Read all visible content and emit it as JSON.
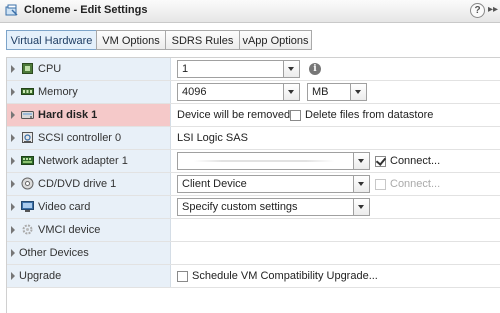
{
  "window": {
    "title": "Cloneme - Edit Settings",
    "help_symbol": "?",
    "more_symbol": "▸▸"
  },
  "tabs": [
    {
      "label": "Virtual Hardware",
      "active": true
    },
    {
      "label": "VM Options",
      "active": false
    },
    {
      "label": "SDRS Rules",
      "active": false
    },
    {
      "label": "vApp Options",
      "active": false
    }
  ],
  "hardware": {
    "cpu": {
      "label": "CPU",
      "value": "1"
    },
    "memory": {
      "label": "Memory",
      "value": "4096",
      "unit": "MB"
    },
    "hard_disk": {
      "label": "Hard disk 1",
      "status": "Device will be removed",
      "delete_files_label": "Delete files from datastore",
      "delete_files_checked": false
    },
    "scsi": {
      "label": "SCSI controller 0",
      "value": "LSI Logic SAS"
    },
    "network": {
      "label": "Network adapter 1",
      "value": "",
      "connect_label": "Connect...",
      "connect_checked": true
    },
    "cddvd": {
      "label": "CD/DVD drive 1",
      "value": "Client Device",
      "connect_label": "Connect...",
      "connect_checked": false
    },
    "video": {
      "label": "Video card",
      "value": "Specify custom settings"
    },
    "vmci": {
      "label": "VMCI device"
    },
    "other": {
      "label": "Other Devices"
    },
    "upgrade": {
      "label": "Upgrade",
      "schedule_label": "Schedule VM Compatibility Upgrade...",
      "schedule_checked": false
    }
  },
  "info_symbol": "i"
}
